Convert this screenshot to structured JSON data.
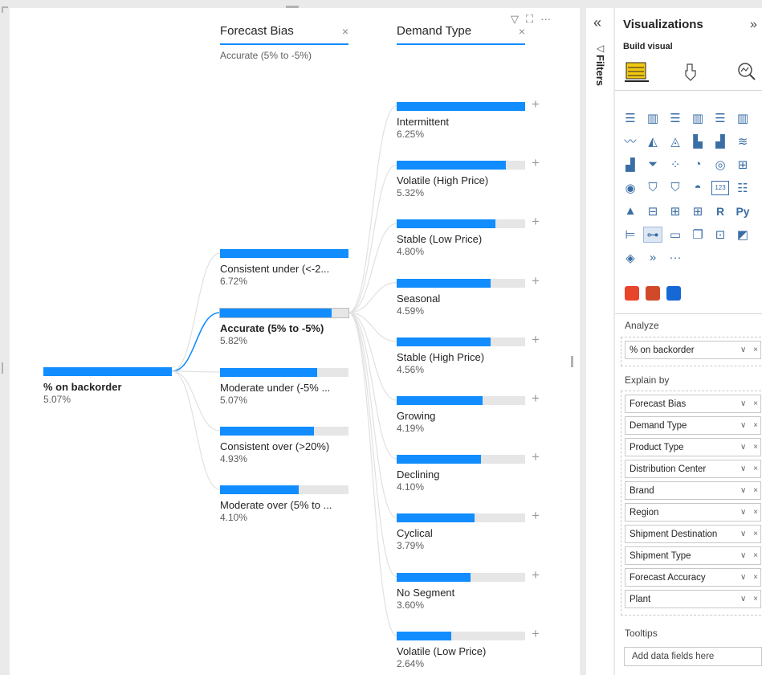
{
  "visual": {
    "tools": [
      "funnel-icon",
      "focus-mode-icon",
      "more-options-icon"
    ],
    "levels": [
      {
        "title": "Forecast Bias",
        "subtitle": "Accurate (5% to -5%)"
      },
      {
        "title": "Demand Type"
      }
    ],
    "close_glyph": "×",
    "root": {
      "label": "% on backorder",
      "value": "5.07%",
      "fill": 1.0
    },
    "level1_nodes": [
      {
        "label": "Consistent under (<-2...",
        "value": "6.72%",
        "fill": 1.0
      },
      {
        "label": "Accurate (5% to -5%)",
        "value": "5.82%",
        "fill": 0.866,
        "selected": true
      },
      {
        "label": "Moderate under (-5% ...",
        "value": "5.07%",
        "fill": 0.754
      },
      {
        "label": "Consistent over (>20%)",
        "value": "4.93%",
        "fill": 0.734
      },
      {
        "label": "Moderate over (5% to ...",
        "value": "4.10%",
        "fill": 0.61
      }
    ],
    "level2_nodes": [
      {
        "label": "Intermittent",
        "value": "6.25%",
        "fill": 1.0
      },
      {
        "label": "Volatile (High Price)",
        "value": "5.32%",
        "fill": 0.851
      },
      {
        "label": "Stable (Low Price)",
        "value": "4.80%",
        "fill": 0.768
      },
      {
        "label": "Seasonal",
        "value": "4.59%",
        "fill": 0.734
      },
      {
        "label": "Stable (High Price)",
        "value": "4.56%",
        "fill": 0.73
      },
      {
        "label": "Growing",
        "value": "4.19%",
        "fill": 0.67
      },
      {
        "label": "Declining",
        "value": "4.10%",
        "fill": 0.656
      },
      {
        "label": "Cyclical",
        "value": "3.79%",
        "fill": 0.606
      },
      {
        "label": "No Segment",
        "value": "3.60%",
        "fill": 0.576
      },
      {
        "label": "Volatile (Low Price)",
        "value": "2.64%",
        "fill": 0.422
      }
    ],
    "expand_glyph": "+"
  },
  "filters": {
    "label": "Filters",
    "collapse_glyph": "«",
    "icon": "filter-arrow-icon"
  },
  "viz_pane": {
    "title": "Visualizations",
    "expand_glyph": "»",
    "build_label": "Build visual",
    "analyze_label": "Analyze",
    "analyze_fields": [
      {
        "name": "% on backorder"
      }
    ],
    "explain_label": "Explain by",
    "explain_fields": [
      {
        "name": "Forecast Bias"
      },
      {
        "name": "Demand Type"
      },
      {
        "name": "Product Type"
      },
      {
        "name": "Distribution Center"
      },
      {
        "name": "Brand"
      },
      {
        "name": "Region"
      },
      {
        "name": "Shipment Destination"
      },
      {
        "name": "Shipment Type"
      },
      {
        "name": "Forecast Accuracy"
      },
      {
        "name": "Plant"
      }
    ],
    "field_controls": "∨ ×",
    "tooltips_label": "Tooltips",
    "tooltips_placeholder": "Add data fields here",
    "icon_rows": [
      [
        "stacked-bar-icon",
        "stacked-column-icon",
        "clustered-bar-icon",
        "clustered-column-icon",
        "100-bar-icon",
        "100-column-icon"
      ],
      [
        "line-icon",
        "area-icon",
        "stacked-area-icon",
        "line-column-icon",
        "line-clustered-icon",
        "ribbon-icon"
      ],
      [
        "waterfall-icon",
        "funnel-icon",
        "scatter-icon",
        "pie-icon",
        "donut-icon",
        "treemap-icon"
      ],
      [
        "map-icon",
        "filled-map-icon",
        "shape-map-icon",
        "gauge-icon",
        "card-icon",
        "multirow-card-icon"
      ],
      [
        "kpi-icon",
        "slicer-icon",
        "table-icon",
        "matrix-icon",
        "r-visual-icon",
        "python-visual-icon"
      ],
      [
        "key-influencers-icon",
        "decomposition-tree-icon",
        "qa-icon",
        "narrative-icon",
        "paginated-report-icon",
        "power-apps-icon"
      ],
      [
        "power-automate-icon",
        "smart-narrative-icon",
        "more-visuals-icon"
      ]
    ],
    "icon_glyphs": [
      [
        "☰",
        "▥",
        "☰",
        "▥",
        "☰",
        "▥"
      ],
      [
        "〰",
        "◭",
        "◬",
        "▙",
        "▟",
        "≋"
      ],
      [
        "▟",
        "⏷",
        "⁘",
        "◔",
        "◎",
        "⊞"
      ],
      [
        "◉",
        "⛉",
        "⛉",
        "◓",
        "123",
        "☷"
      ],
      [
        "▲",
        "⊟",
        "⊞",
        "⊞",
        "R",
        "Py"
      ],
      [
        "⊨",
        "⊶",
        "▭",
        "❐",
        "⊡",
        "◩"
      ],
      [
        "◈",
        "»",
        "···"
      ]
    ],
    "custom_icons": [
      {
        "name": "html-content-icon",
        "color": "#e8442c"
      },
      {
        "name": "custom-grid-icon",
        "color": "#d04a2a"
      },
      {
        "name": "custom-circle-icon",
        "color": "#1668d6"
      }
    ]
  }
}
